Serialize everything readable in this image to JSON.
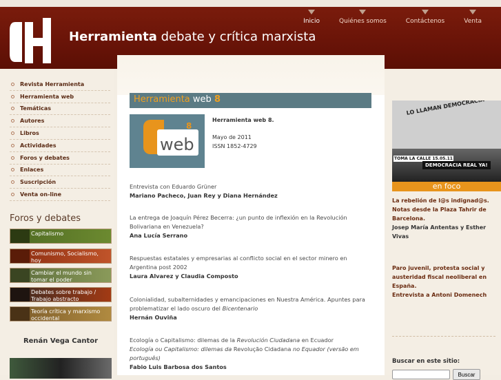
{
  "nav": {
    "top": [
      {
        "label": "Inicio",
        "active": true
      },
      {
        "label": "Quiénes somos",
        "active": false
      },
      {
        "label": "Contáctenos",
        "active": false
      },
      {
        "label": "Venta",
        "active": false
      }
    ]
  },
  "site": {
    "name": "Herramienta",
    "tagline": "debate y crítica marxista"
  },
  "sidebar": {
    "items": [
      {
        "label": "Revista Herramienta"
      },
      {
        "label": "Herramienta web"
      },
      {
        "label": "Temáticas"
      },
      {
        "label": "Autores"
      },
      {
        "label": "Libros"
      },
      {
        "label": "Actividades"
      },
      {
        "label": "Foros y debates"
      },
      {
        "label": "Enlaces"
      },
      {
        "label": "Suscripción"
      },
      {
        "label": "Venta on-line"
      }
    ],
    "foros_title": "Foros y debates",
    "banners": [
      {
        "label": "Capitalismo"
      },
      {
        "label": "Comunismo, Socialismo, hoy"
      },
      {
        "label": "Cambiar el mundo sin tomar el poder"
      },
      {
        "label": "Debates sobre trabajo / Trabajo abstracto"
      },
      {
        "label": "Teoría crítica y marxismo occidental"
      }
    ],
    "featured_author": "Renán Vega Cantor"
  },
  "article": {
    "header_left": "Herramienta",
    "header_mid": "web",
    "header_num": "8",
    "issue_name": "Herramienta web 8.",
    "date": "Mayo de 2011",
    "issn": "ISSN 1852-4729",
    "cover_num": "8",
    "cover_word": "web"
  },
  "entries": [
    {
      "title": "Entrevista con Eduardo Grüner",
      "author": "Mariano Pacheco,  Juan Rey y Diana Hernández"
    },
    {
      "title": "La entrega de Joaquín Pérez Becerra: ¿un punto de inflexión en la Revolución Bolivariana en Venezuela?",
      "author": "Ana Lucía Serrano"
    },
    {
      "title": "Respuestas estatales y empresarias al conflicto social en el sector minero en Argentina post 2002",
      "author": "Laura Alvarez y Claudia Composto"
    },
    {
      "title_a": "Colonialidad, subalternidades y emancipaciones en Nuestra América. Apuntes para problematizar el lado oscuro del ",
      "title_i": "Bicentenario",
      "author": "Hernán Ouviña"
    },
    {
      "title_a": "Ecología o Capitalismo: dilemas de la ",
      "title_i": "Revolución Ciudadana",
      "title_b": " en Ecuador",
      "sub_i": "Ecología ou Capitalismo: dilemas da ",
      "sub_a": "Revolução Cidadana",
      "sub_i2": " no Equador (versão em português)",
      "author": "Fabio Luis Barbosa dos Santos"
    }
  ],
  "right": {
    "enfoco": "en foco",
    "img_banner": "LO LLAMAN DEMOCRACIA",
    "img_sign": "DEMOCRACIA REAL YA!",
    "img_tag": "TOMA LA CALLE 15.05.11",
    "item1_title": "La rebelión de l@s indignad@s. Notas desde la Plaza Tahrir de Barcelona.",
    "item1_author": "Josep María Antentas y Esther Vivas",
    "item2_title": "Paro juvenil,  protesta social y austeridad fiscal neoliberal en España.",
    "item2_sub": "Entrevista a Antoni Domenech",
    "search_label": "Buscar en este sitio:",
    "search_button": "Buscar"
  }
}
